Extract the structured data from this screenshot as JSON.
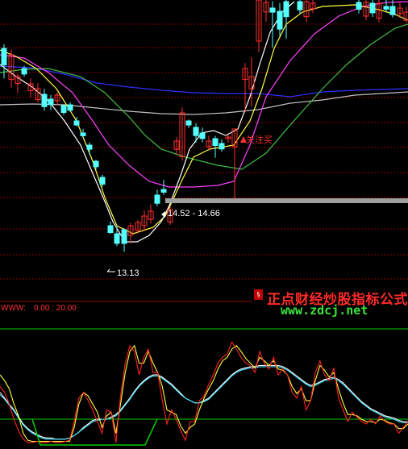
{
  "colors": {
    "background": "#000000",
    "grid": "#8b0000",
    "candle_up": "#ff3030",
    "candle_down": "#54ffff",
    "ma_white": "#ffffff",
    "ma_yellow": "#ffff40",
    "ma_magenta": "#ff40ff",
    "ma_green": "#40c040",
    "ma_blue": "#3030ff",
    "ma_grey": "#c0c0c0",
    "band": "#a0a0a0",
    "label": "#ffffff",
    "signal": "#ff3030",
    "indicator_label": "#ff3030",
    "osc_k": "#ff2020",
    "osc_d": "#ffff40",
    "osc_slow1": "#ffffff",
    "osc_slow2": "#40e0ff",
    "osc_level": "#00cc00"
  },
  "chart_data": {
    "type": "candlestick",
    "candles": [
      [
        130,
        142,
        120,
        145,
        -1
      ],
      [
        124,
        142,
        118,
        146,
        1
      ],
      [
        131,
        136,
        124,
        138,
        1
      ],
      [
        117,
        121,
        115,
        123,
        -1
      ],
      [
        115,
        120,
        110,
        124,
        1
      ],
      [
        106,
        114,
        104,
        118,
        1
      ],
      [
        101,
        110,
        98,
        114,
        -1
      ],
      [
        100,
        104,
        96,
        107,
        -1
      ],
      [
        98,
        102,
        95,
        104,
        1
      ],
      [
        92,
        97,
        90,
        98,
        -1
      ],
      [
        86,
        90,
        85,
        92,
        -1
      ],
      [
        84,
        87,
        83,
        90,
        -1
      ],
      [
        82,
        84,
        81,
        87,
        -1
      ],
      [
        76,
        79,
        72,
        81,
        -1
      ],
      [
        68,
        72,
        66,
        73,
        -1
      ],
      [
        62,
        67,
        60,
        69,
        -1
      ],
      [
        51,
        56,
        50,
        59,
        -1
      ],
      [
        40,
        47,
        38,
        52,
        -1
      ],
      [
        21,
        31,
        15,
        32,
        -1
      ],
      [
        22,
        29,
        16,
        31,
        1
      ],
      [
        20,
        26,
        18,
        28,
        1
      ],
      [
        28,
        35,
        24,
        39,
        1
      ],
      [
        27,
        33,
        24,
        38,
        1
      ],
      [
        36,
        42,
        34,
        46,
        -1
      ],
      [
        44,
        46,
        42,
        53,
        -1
      ],
      [
        36,
        45,
        34,
        47,
        1
      ],
      [
        86,
        92,
        82,
        95,
        1
      ],
      [
        45,
        77,
        42,
        81,
        1
      ],
      [
        84,
        87,
        82,
        88,
        -1
      ],
      [
        80,
        86,
        75,
        89,
        -1
      ],
      [
        79,
        83,
        76,
        87,
        -1
      ],
      [
        78,
        82,
        75,
        86,
        1
      ],
      [
        79,
        84,
        70,
        86,
        -1
      ],
      [
        73,
        77,
        71,
        80,
        -1
      ],
      [
        76,
        77,
        73,
        79,
        1
      ],
      [
        112,
        125,
        74,
        125,
        1
      ],
      [
        112,
        120,
        88,
        124,
        1
      ],
      [
        143,
        152,
        130,
        166,
        1
      ],
      [
        158,
        188,
        150,
        200,
        1
      ],
      [
        179,
        186,
        172,
        195,
        1
      ],
      [
        174,
        177,
        148,
        182,
        -1
      ],
      [
        171,
        184,
        166,
        190,
        -1
      ],
      [
        176,
        187,
        160,
        193,
        -1
      ],
      [
        183,
        189,
        180,
        191,
        -1
      ],
      [
        178,
        189,
        174,
        193,
        1
      ],
      [
        184,
        188,
        181,
        192,
        1
      ],
      [
        175,
        180,
        172,
        185,
        -1
      ],
      [
        182,
        192,
        179,
        196,
        1
      ],
      [
        181,
        188,
        178,
        192,
        -1
      ],
      [
        179,
        190,
        176,
        194,
        1
      ],
      [
        190,
        192,
        188,
        199,
        -1
      ],
      [
        178,
        184,
        176,
        189,
        -1
      ],
      [
        177,
        181,
        174,
        186,
        1
      ],
      [
        174,
        180,
        172,
        184,
        1
      ]
    ],
    "candle_format": "[low_body, high_body, low, high, dir] where dir 1 = up (hollow red), -1 = down (filled cyan)",
    "labels": {
      "low_price": "13.13",
      "band_price": "14.52 - 14.66",
      "signal": "关注买"
    },
    "indicator": {
      "name": "WWW:",
      "values": "0.00 : 20.00",
      "levels": [
        80,
        20
      ],
      "k": [
        50,
        45,
        35,
        22,
        12,
        5,
        2,
        2,
        3,
        2,
        2,
        3,
        2,
        2,
        3,
        4,
        20,
        40,
        45,
        38,
        30,
        20,
        10,
        30,
        28,
        2,
        42,
        70,
        85,
        80,
        60,
        75,
        82,
        62,
        62,
        38,
        18,
        30,
        22,
        12,
        4,
        20,
        20,
        38,
        42,
        52,
        60,
        70,
        75,
        78,
        88,
        82,
        75,
        70,
        68,
        62,
        80,
        70,
        65,
        75,
        60,
        65,
        60,
        45,
        40,
        50,
        30,
        38,
        62,
        72,
        60,
        55,
        66,
        40,
        30,
        20,
        28,
        24,
        20,
        18,
        22,
        18,
        25,
        20,
        18,
        18,
        10,
        15,
        20
      ],
      "d": [
        60,
        55,
        48,
        35,
        25,
        10,
        4,
        3,
        3,
        3,
        3,
        3,
        3,
        3,
        3,
        3,
        15,
        35,
        45,
        42,
        35,
        28,
        15,
        25,
        28,
        10,
        35,
        62,
        80,
        85,
        70,
        70,
        80,
        70,
        62,
        50,
        30,
        28,
        26,
        16,
        10,
        15,
        18,
        30,
        40,
        48,
        55,
        65,
        72,
        75,
        82,
        85,
        80,
        74,
        70,
        66,
        75,
        72,
        68,
        72,
        65,
        64,
        60,
        50,
        44,
        48,
        38,
        38,
        55,
        68,
        64,
        58,
        62,
        48,
        36,
        26,
        26,
        25,
        22,
        20,
        20,
        19,
        22,
        21,
        19,
        18,
        14,
        14,
        18
      ],
      "slow1": [
        45,
        40,
        35,
        30,
        24,
        18,
        14,
        11,
        9,
        7,
        6,
        6,
        5,
        5,
        5,
        6,
        8,
        11,
        15,
        18,
        21,
        22,
        22,
        22,
        24,
        26,
        30,
        35,
        40,
        46,
        51,
        55,
        58,
        60,
        60,
        58,
        55,
        52,
        48,
        44,
        40,
        38,
        36,
        36,
        38,
        40,
        44,
        48,
        52,
        56,
        60,
        63,
        65,
        66,
        67,
        67,
        68,
        68,
        68,
        68,
        68,
        67,
        65,
        62,
        59,
        56,
        53,
        51,
        52,
        54,
        56,
        57,
        58,
        56,
        53,
        49,
        45,
        41,
        37,
        34,
        31,
        29,
        27,
        25,
        24,
        23,
        21,
        20,
        20
      ],
      "slow2": [
        43,
        39,
        34,
        29,
        23,
        17,
        13,
        10,
        8,
        6,
        5,
        5,
        5,
        5,
        5,
        6,
        8,
        11,
        14,
        17,
        20,
        21,
        22,
        22,
        23,
        25,
        29,
        34,
        39,
        45,
        50,
        54,
        57,
        59,
        59,
        57,
        54,
        51,
        47,
        43,
        40,
        38,
        36,
        36,
        37,
        39,
        43,
        47,
        51,
        55,
        59,
        62,
        64,
        65,
        66,
        66,
        67,
        67,
        67,
        67,
        67,
        66,
        64,
        61,
        58,
        55,
        52,
        50,
        51,
        53,
        55,
        56,
        57,
        55,
        52,
        48,
        44,
        40,
        36,
        33,
        30,
        28,
        26,
        24,
        23,
        22,
        20,
        19,
        19
      ]
    },
    "moving_averages": [
      {
        "key": "ma_blue",
        "y": [
          300,
          290,
          282,
          270,
          260,
          248,
          238,
          225,
          215,
          205,
          195,
          188,
          182,
          176,
          172,
          170,
          168,
          170,
          172,
          176,
          182,
          190,
          200,
          212,
          225,
          238,
          250
        ]
      },
      {
        "key": "ma_grey",
        "y": [
          305,
          295,
          280,
          262,
          245,
          226,
          210,
          196,
          182,
          170,
          160,
          152,
          146,
          142,
          140,
          140,
          142,
          147,
          154,
          162,
          172,
          184,
          198,
          214,
          230,
          246,
          260
        ]
      }
    ],
    "watermark": {
      "title": "正点财经炒股指标公式",
      "url": "www.zdcj.net"
    }
  }
}
